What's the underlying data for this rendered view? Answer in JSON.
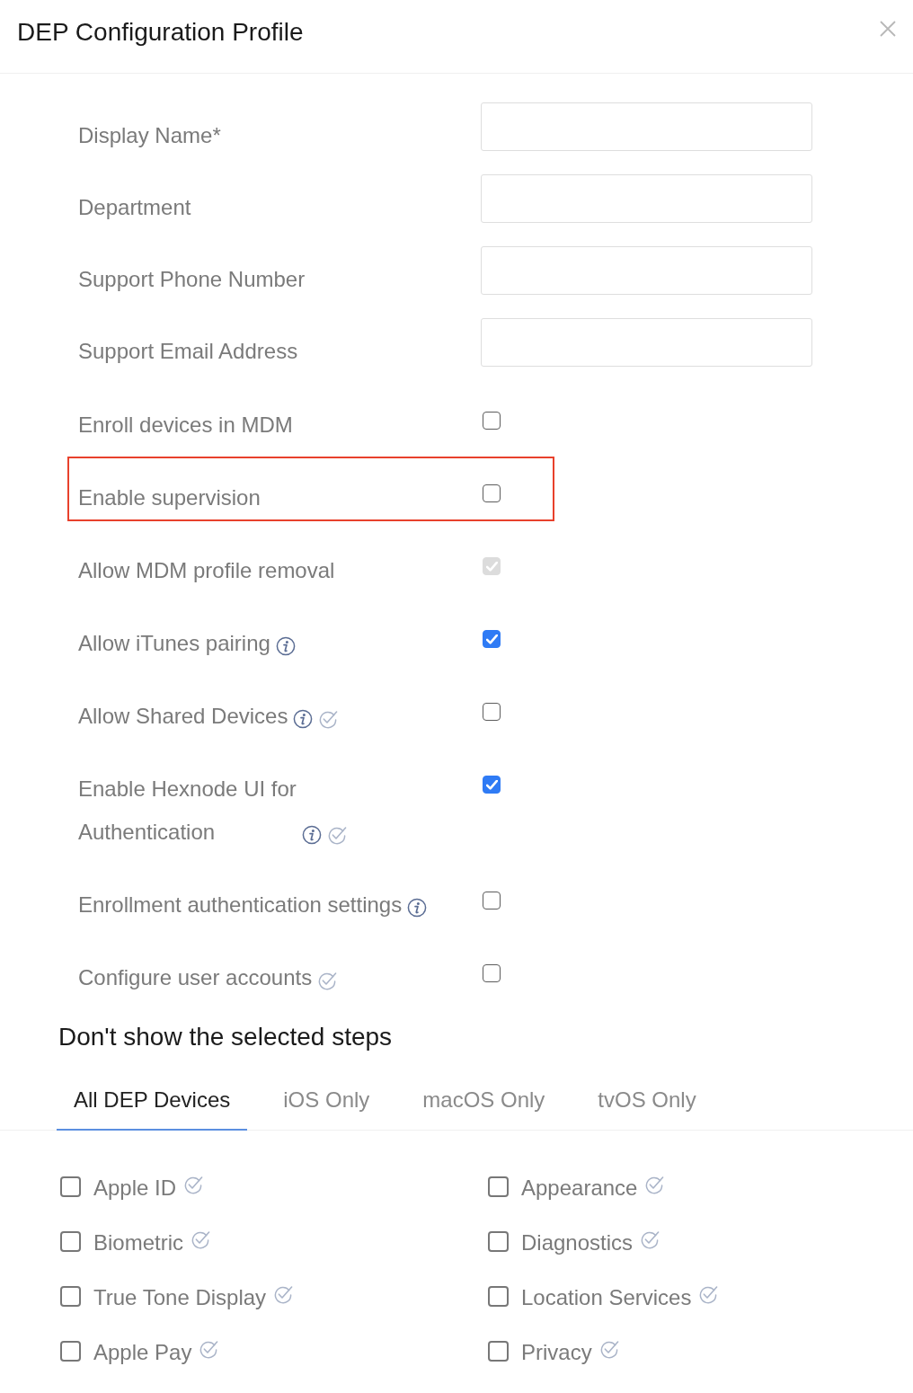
{
  "dialog": {
    "title": "DEP Configuration Profile"
  },
  "form": {
    "fields": [
      {
        "label": "Display Name*"
      },
      {
        "label": "Department"
      },
      {
        "label": "Support Phone Number"
      },
      {
        "label": "Support Email Address"
      }
    ],
    "options": [
      {
        "label": "Enroll devices in MDM",
        "checked": false,
        "disabled": false,
        "highlighted": false,
        "info": false,
        "verified": false
      },
      {
        "label": "Enable supervision",
        "checked": false,
        "disabled": false,
        "highlighted": true,
        "info": false,
        "verified": false
      },
      {
        "label": "Allow MDM profile removal",
        "checked": true,
        "disabled": true,
        "highlighted": false,
        "info": false,
        "verified": false
      },
      {
        "label": "Allow iTunes pairing",
        "checked": true,
        "disabled": false,
        "highlighted": false,
        "info": true,
        "verified": false
      },
      {
        "label": "Allow Shared Devices",
        "checked": false,
        "disabled": false,
        "highlighted": false,
        "info": true,
        "verified": true
      },
      {
        "label": "Enable Hexnode UI for\nAuthentication",
        "checked": true,
        "disabled": false,
        "highlighted": false,
        "info": true,
        "verified": true
      },
      {
        "label": "Enrollment authentication settings",
        "checked": false,
        "disabled": false,
        "highlighted": false,
        "info": true,
        "verified": false
      },
      {
        "label": "Configure user accounts",
        "checked": false,
        "disabled": false,
        "highlighted": false,
        "info": false,
        "verified": true
      }
    ]
  },
  "steps": {
    "heading": "Don't show the selected steps",
    "tabs": [
      {
        "label": "All DEP Devices",
        "selected": true
      },
      {
        "label": "iOS Only",
        "selected": false
      },
      {
        "label": "macOS Only",
        "selected": false
      },
      {
        "label": "tvOS Only",
        "selected": false
      }
    ],
    "items": [
      {
        "label": "Apple ID",
        "checked": false,
        "verified": true
      },
      {
        "label": "Appearance",
        "checked": false,
        "verified": true
      },
      {
        "label": "Biometric",
        "checked": false,
        "verified": true
      },
      {
        "label": "Diagnostics",
        "checked": false,
        "verified": true
      },
      {
        "label": "True Tone Display",
        "checked": false,
        "verified": true
      },
      {
        "label": "Location Services",
        "checked": false,
        "verified": true
      },
      {
        "label": "Apple Pay",
        "checked": false,
        "verified": true
      },
      {
        "label": "Privacy",
        "checked": false,
        "verified": true
      }
    ]
  }
}
